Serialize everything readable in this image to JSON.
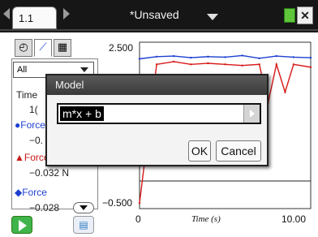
{
  "topbar": {
    "tab_label": "1.1",
    "document_title": "*Unsaved",
    "icons": {
      "back": "chevron-left-icon",
      "forward": "chevron-right-icon",
      "caret": "caret-down-icon",
      "battery": "battery-icon",
      "close": "close-icon"
    }
  },
  "left_panel": {
    "tool_icons": [
      "gauge-icon",
      "graph-icon",
      "table-icon"
    ],
    "selector_value": "All",
    "rows": [
      {
        "text": "Time",
        "style": "plain"
      },
      {
        "text": "1(",
        "style": "plain"
      },
      {
        "text": "●Force",
        "style": "blue"
      },
      {
        "text": "−0.",
        "style": "plain"
      },
      {
        "text": "▲Force",
        "style": "red"
      },
      {
        "text": "−0.032 N",
        "style": "plain"
      },
      {
        "text": "◆Force",
        "style": "blue"
      },
      {
        "text": "−0.028",
        "style": "plain"
      }
    ]
  },
  "graph": {
    "y_max_label": "2.500",
    "y_min_label": "−0.500",
    "x_min_label": "0",
    "x_max_label": "10.00",
    "x_axis_title": "Time (s)"
  },
  "dialog": {
    "title": "Model",
    "input_value": "m*x + b",
    "ok_label": "OK",
    "cancel_label": "Cancel"
  },
  "colors": {
    "series_blue": "#1c3fd0",
    "series_red": "#d81818",
    "accent_green": "#3fb44a"
  },
  "chart_data": {
    "type": "line",
    "x_range": [
      0,
      10.0
    ],
    "y_range": [
      -0.5,
      2.5
    ],
    "xlabel": "Time (s)",
    "series": [
      {
        "color": "#1c3fd0",
        "x": [
          0.0,
          1,
          2,
          3,
          4,
          5,
          6,
          7,
          8,
          9,
          10
        ],
        "y": [
          2.2,
          2.24,
          2.25,
          2.22,
          2.24,
          2.23,
          2.26,
          2.21,
          2.25,
          2.23,
          2.22
        ]
      },
      {
        "color": "#d81818",
        "x": [
          0.0,
          1,
          2,
          3,
          4,
          5,
          6,
          7,
          7.5,
          8,
          8.5,
          9,
          10
        ],
        "y": [
          -0.4,
          2.1,
          2.15,
          2.1,
          2.12,
          2.1,
          2.08,
          2.1,
          1.4,
          2.1,
          1.6,
          2.1,
          2.05
        ]
      }
    ]
  }
}
